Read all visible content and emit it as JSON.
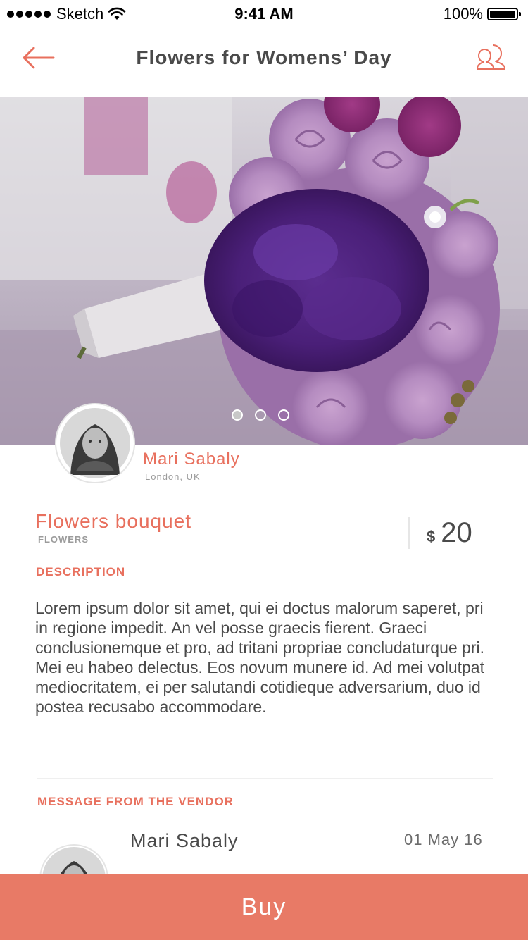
{
  "status_bar": {
    "carrier": "Sketch",
    "time": "9:41 AM",
    "battery": "100%"
  },
  "nav": {
    "title": "Flowers for Womens’ Day",
    "back_icon": "arrow-left-icon",
    "chat_icon": "users-chat-icon"
  },
  "gallery": {
    "pages": 3,
    "active_index": 0
  },
  "vendor": {
    "name": "Mari Sabaly",
    "location": "London, UK"
  },
  "product": {
    "name": "Flowers bouquet",
    "category": "FLOWERS",
    "currency": "$",
    "price": "20"
  },
  "description": {
    "label": "DESCRIPTION",
    "text": " Lorem ipsum dolor sit amet, qui ei doctus malorum saperet, pri in regione impedit. An vel posse graecis fierent. Graeci conclusionemque et pro, ad tritani propriae concludaturque pri.\n Mei eu habeo delectus. Eos novum munere id. Ad mei volutpat mediocritatem, ei per salutandi cotidieque adversarium, duo id postea recusabo accommodare."
  },
  "vendor_message": {
    "label": "MESSAGE FROM THE VENDOR",
    "name": "Mari Sabaly",
    "date": "01 May 16"
  },
  "actions": {
    "buy_label": "Buy"
  },
  "colors": {
    "accent": "#e8705e",
    "buy_button": "#e87a66",
    "text": "#4a4a4a",
    "muted": "#9b9b9b"
  }
}
